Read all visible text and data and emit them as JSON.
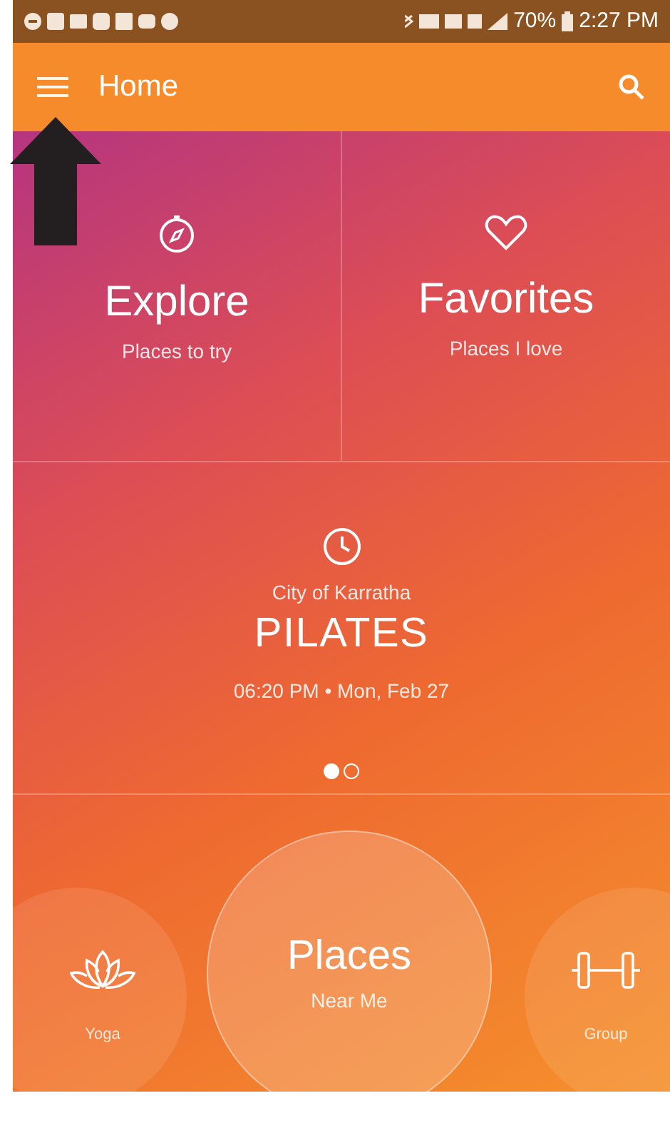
{
  "status_bar": {
    "battery": "70%",
    "time": "2:27 PM"
  },
  "app_bar": {
    "title": "Home"
  },
  "tiles": [
    {
      "kind": "explore",
      "title": "Explore",
      "subtitle": "Places to try"
    },
    {
      "kind": "favorites",
      "title": "Favorites",
      "subtitle": "Places I love"
    }
  ],
  "featured": {
    "location": "City of Karratha",
    "title": "PILATES",
    "when": "06:20 PM • Mon, Feb 27"
  },
  "pager": [
    {
      "selected": true
    },
    {
      "selected": false
    }
  ],
  "carousel": [
    {
      "kind": "yoga",
      "label": "Yoga",
      "selected": false
    },
    {
      "title": "Places",
      "label": "Near Me",
      "selected": true
    },
    {
      "kind": "group",
      "label": "Group",
      "selected": false
    }
  ]
}
